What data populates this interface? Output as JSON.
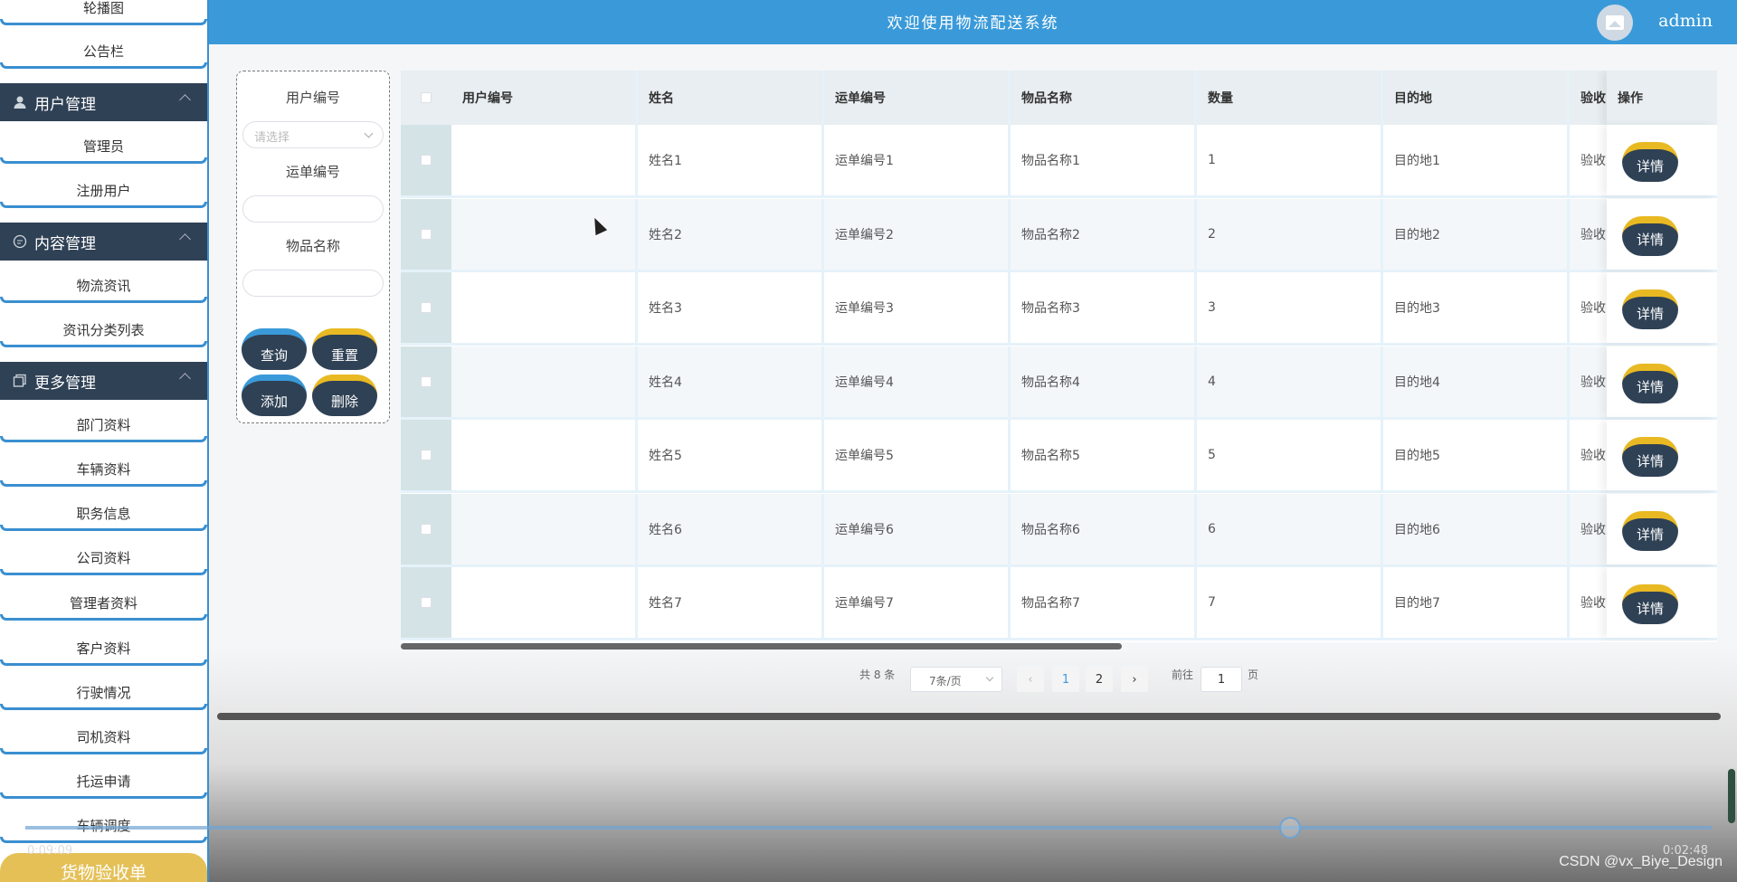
{
  "header": {
    "title": "欢迎使用物流配送系统",
    "username": "admin"
  },
  "sidebar": {
    "items_top": [
      "轮播图",
      "公告栏"
    ],
    "groups": [
      {
        "title": "用户管理",
        "items": [
          "管理员",
          "注册用户"
        ]
      },
      {
        "title": "内容管理",
        "items": [
          "物流资讯",
          "资讯分类列表"
        ]
      },
      {
        "title": "更多管理",
        "items": [
          "部门资料",
          "车辆资料",
          "职务信息",
          "公司资料",
          "管理者资料",
          "客户资料",
          "行驶情况",
          "司机资料",
          "托运申请",
          "车辆调度"
        ]
      }
    ],
    "highlighted": "货物验收单"
  },
  "search": {
    "user_no_label": "用户编号",
    "select_placeholder": "请选择",
    "waybill_label": "运单编号",
    "item_label": "物品名称",
    "query_btn": "查询",
    "reset_btn": "重置",
    "add_btn": "添加",
    "delete_btn": "删除"
  },
  "table": {
    "columns": [
      "用户编号",
      "姓名",
      "运单编号",
      "物品名称",
      "数量",
      "目的地",
      "验收",
      "操作"
    ],
    "rows": [
      {
        "user_no": "",
        "name": "姓名1",
        "waybill": "运单编号1",
        "item": "物品名称1",
        "qty": "1",
        "dest": "目的地1",
        "check": "验收"
      },
      {
        "user_no": "",
        "name": "姓名2",
        "waybill": "运单编号2",
        "item": "物品名称2",
        "qty": "2",
        "dest": "目的地2",
        "check": "验收"
      },
      {
        "user_no": "",
        "name": "姓名3",
        "waybill": "运单编号3",
        "item": "物品名称3",
        "qty": "3",
        "dest": "目的地3",
        "check": "验收"
      },
      {
        "user_no": "",
        "name": "姓名4",
        "waybill": "运单编号4",
        "item": "物品名称4",
        "qty": "4",
        "dest": "目的地4",
        "check": "验收"
      },
      {
        "user_no": "",
        "name": "姓名5",
        "waybill": "运单编号5",
        "item": "物品名称5",
        "qty": "5",
        "dest": "目的地5",
        "check": "验收"
      },
      {
        "user_no": "",
        "name": "姓名6",
        "waybill": "运单编号6",
        "item": "物品名称6",
        "qty": "6",
        "dest": "目的地6",
        "check": "验收"
      },
      {
        "user_no": "",
        "name": "姓名7",
        "waybill": "运单编号7",
        "item": "物品名称7",
        "qty": "7",
        "dest": "目的地7",
        "check": "验收"
      }
    ],
    "detail_btn": "详情"
  },
  "pagination": {
    "total": "共 8 条",
    "page_size": "7条/页",
    "pages": [
      "1",
      "2"
    ],
    "current": "1",
    "goto_label": "前往",
    "goto_value": "1",
    "page_suffix": "页"
  },
  "video": {
    "elapsed": "0:09:09",
    "remaining": "0:02:48",
    "progress": 0.75
  },
  "watermark": "CSDN @vx_Biye_Design"
}
